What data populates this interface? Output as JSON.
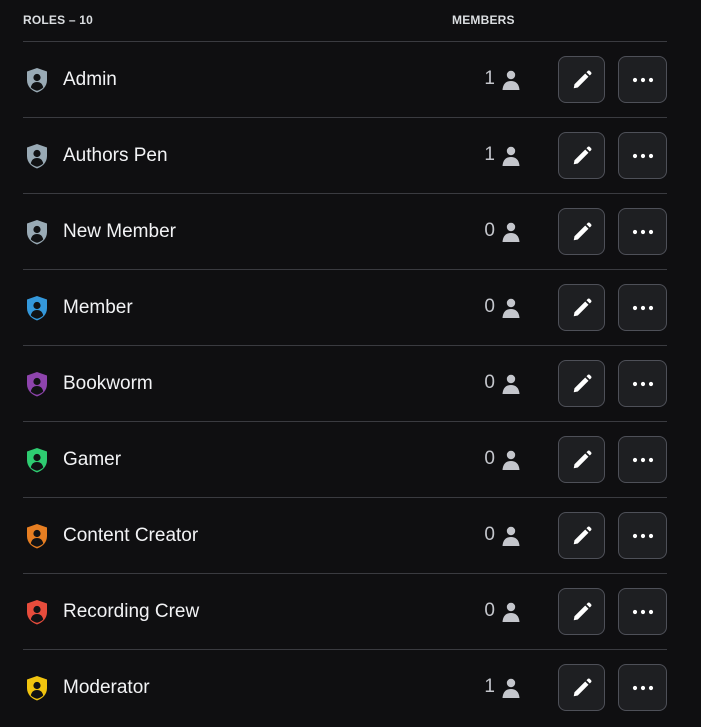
{
  "header": {
    "roles_label": "ROLES – 10",
    "members_label": "MEMBERS"
  },
  "icons": {
    "role": "shield-person-icon",
    "member": "person-icon",
    "edit": "pencil-icon",
    "more": "more-dots-icon"
  },
  "roles": [
    {
      "name": "Admin",
      "members": "1",
      "color": "#99aab5"
    },
    {
      "name": "Authors Pen",
      "members": "1",
      "color": "#99aab5"
    },
    {
      "name": "New Member",
      "members": "0",
      "color": "#99aab5"
    },
    {
      "name": "Member",
      "members": "0",
      "color": "#3498db"
    },
    {
      "name": "Bookworm",
      "members": "0",
      "color": "#8e44ad"
    },
    {
      "name": "Gamer",
      "members": "0",
      "color": "#2ecc71"
    },
    {
      "name": "Content Creator",
      "members": "0",
      "color": "#e67e22"
    },
    {
      "name": "Recording Crew",
      "members": "0",
      "color": "#e74c3c"
    },
    {
      "name": "Moderator",
      "members": "1",
      "color": "#f1c40f"
    }
  ]
}
